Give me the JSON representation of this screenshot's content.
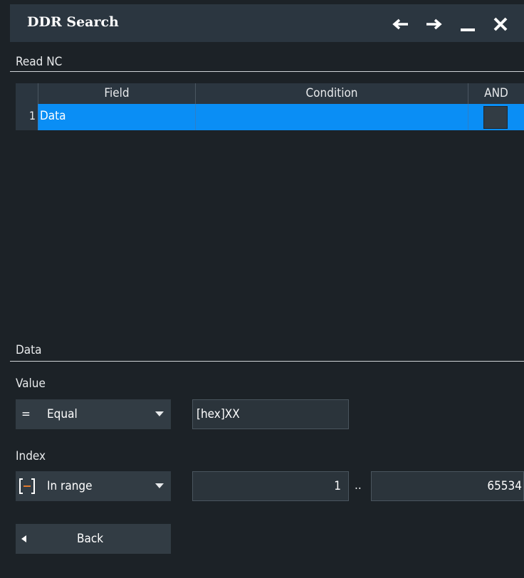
{
  "window": {
    "title": "DDR Search",
    "controls": [
      "arrow-left-icon",
      "arrow-right-icon",
      "minimize-icon",
      "close-icon"
    ]
  },
  "section1": {
    "label": "Read NC"
  },
  "table": {
    "headers": {
      "field": "Field",
      "condition": "Condition",
      "and": "AND"
    },
    "rows": [
      {
        "num": "1",
        "field": "Data",
        "condition": "",
        "and_checked": false,
        "selected": true
      }
    ]
  },
  "section2": {
    "label": "Data"
  },
  "value": {
    "label": "Value",
    "operator_icon": "=",
    "operator": "Equal",
    "input": "[hex]XX"
  },
  "index": {
    "label": "Index",
    "operator_icon": "[−]",
    "operator": "In range",
    "from": "1",
    "separator": "..",
    "to": "65534"
  },
  "footer": {
    "back_label": "Back"
  },
  "colors": {
    "background": "#1c2227",
    "titlebar": "#2b3640",
    "selected_row": "#0a8ef5",
    "accent_orange": "#e07a2e"
  }
}
